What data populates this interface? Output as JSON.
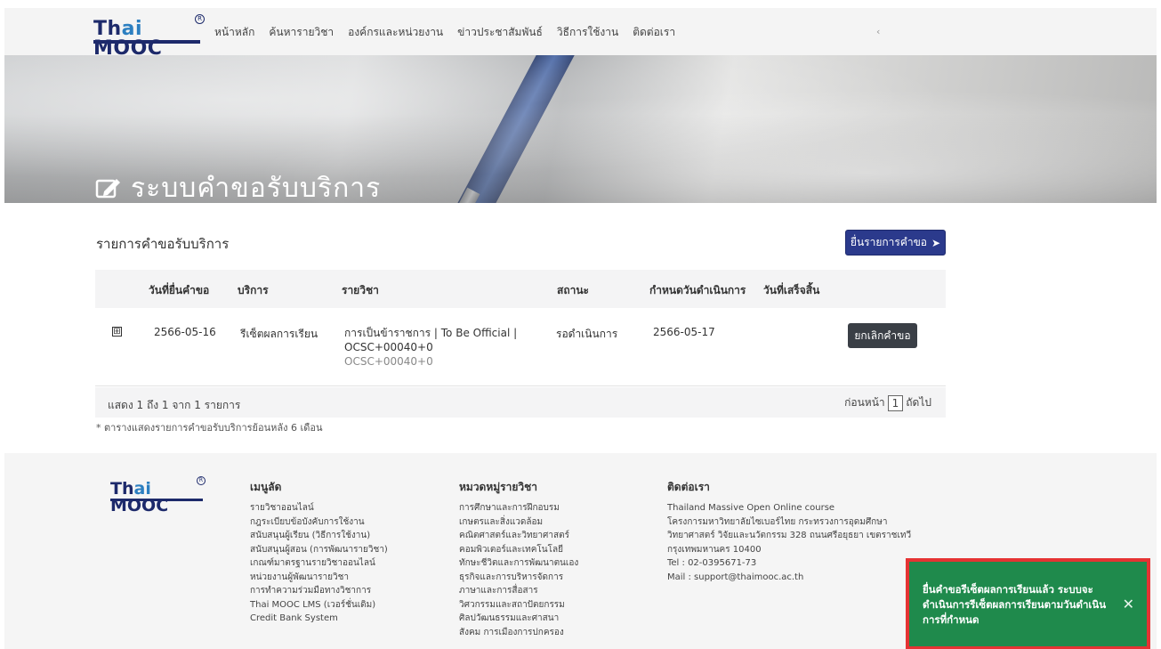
{
  "brand": {
    "logo_text_prefix": "Th",
    "logo_text_highlight": "ai",
    "logo_text_suffix": " MOOC",
    "primary_color": "#2b3a8c",
    "toast_color": "#1f8a4c",
    "highlight_color": "#e53333"
  },
  "nav": {
    "items": [
      "หน้าหลัก",
      "ค้นหารายวิชา",
      "องค์กรและหน่วยงาน",
      "ข่าวประชาสัมพันธ์",
      "วิธีการใช้งาน",
      "ติดต่อเรา"
    ],
    "extra": "‹"
  },
  "hero": {
    "title": "ระบบคำขอรับบริการ",
    "icon": "edit-document-icon"
  },
  "requests": {
    "section_title": "รายการคำขอรับบริการ",
    "submit_label": "ยื่นรายการคำขอ",
    "columns": [
      "วันที่ยื่นคำขอ",
      "บริการ",
      "รายวิชา",
      "สถานะ",
      "กำหนดวันดำเนินการ",
      "วันที่เสร็จสิ้น"
    ],
    "rows": [
      {
        "expand_icon": "⊞",
        "submit_date": "2566-05-16",
        "service": "รีเซ็ตผลการเรียน",
        "course_line1": "การเป็นข้าราชการ | To Be Official |",
        "course_line2": "OCSC+00040+0",
        "course_code": "OCSC+00040+0",
        "status": "รอดำเนินการ",
        "due_date": "2566-05-17",
        "finish_date": "",
        "action_label": "ยกเลิกคำขอ"
      }
    ],
    "footer_info": "แสดง 1 ถึง 1 จาก 1 รายการ",
    "pager": {
      "prev": "ก่อนหน้า",
      "page": "1",
      "next": "ถัดไป"
    },
    "note": "* ตารางแสดงรายการคำขอรับบริการย้อนหลัง 6 เดือน"
  },
  "footer": {
    "menu": {
      "title": "เมนูลัด",
      "items": [
        "รายวิชาออนไลน์",
        "กฎระเบียบข้อบังคับการใช้งาน",
        "สนับสนุนผู้เรียน (วิธีการใช้งาน)",
        "สนับสนุนผู้สอน (การพัฒนารายวิชา)",
        "เกณฑ์มาตรฐานรายวิชาออนไลน์",
        "หน่วยงานผู้พัฒนารายวิชา",
        "การทำความร่วมมือทางวิชาการ",
        "Thai MOOC LMS (เวอร์ชั่นเดิม)",
        "Credit Bank System"
      ]
    },
    "categories": {
      "title": "หมวดหมู่รายวิชา",
      "items": [
        "การศึกษาและการฝึกอบรม",
        "เกษตรและสิ่งแวดล้อม",
        "คณิตศาสตร์และวิทยาศาสตร์",
        "คอมพิวเตอร์และเทคโนโลยี",
        "ทักษะชีวิตและการพัฒนาตนเอง",
        "ธุรกิจและการบริหารจัดการ",
        "ภาษาและการสื่อสาร",
        "วิศวกรรมและสถาปัตยกรรม",
        "ศิลปวัฒนธรรมและศาสนา",
        "สังคม การเมืองการปกครอง"
      ]
    },
    "contact": {
      "title": "ติดต่อเรา",
      "lines": [
        "Thailand Massive Open Online course",
        "โครงการมหาวิทยาลัยไซเบอร์ไทย กระทรวงการอุดมศึกษา",
        "วิทยาศาสตร์ วิจัยและนวัตกรรม 328 ถนนศรีอยุธยา เขตราชเทวี",
        "กรุงเทพมหานคร 10400",
        "Tel : 02-0395671-73",
        "Mail : support@thaimooc.ac.th"
      ]
    }
  },
  "toast": {
    "message": "ยื่นคำขอรีเซ็ตผลการเรียนแล้ว ระบบจะดำเนินการรีเซ็ตผลการเรียนตามวันดำเนินการที่กำหนด",
    "close": "✕"
  }
}
